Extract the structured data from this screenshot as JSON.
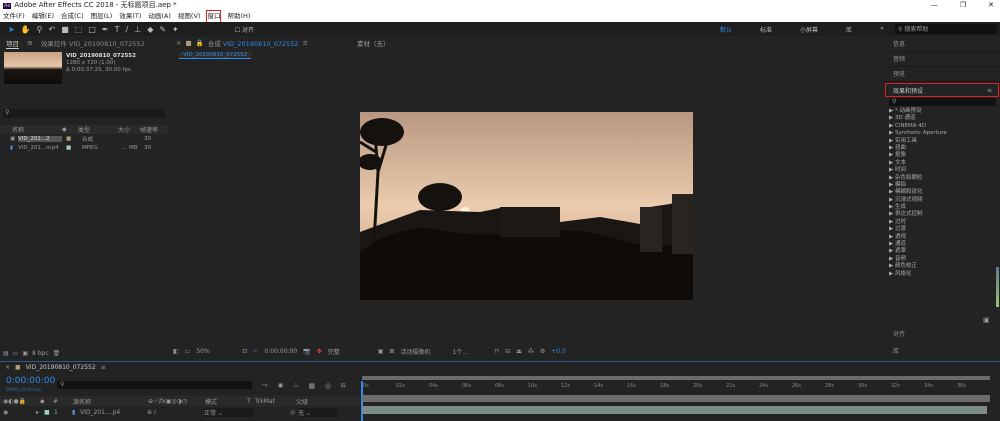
{
  "app": {
    "title": "Adobe After Effects CC 2018 - 无标题项目.aep *",
    "logo": "Ae"
  },
  "window_controls": [
    "—",
    "❐",
    "✕"
  ],
  "menu": [
    "文件(F)",
    "编辑(E)",
    "合成(C)",
    "图层(L)",
    "效果(T)",
    "动画(A)",
    "视图(V)",
    "窗口",
    "帮助(H)"
  ],
  "toolbar": {
    "tools": [
      "selection-icon",
      "hand-icon",
      "zoom-icon",
      "rotate-icon",
      "camera-icon",
      "pan-behind-icon",
      "rectangle-icon",
      "pen-icon",
      "type-icon",
      "brush-icon",
      "clone-stamp-icon",
      "eraser-icon",
      "roto-brush-icon",
      "puppet-pin-icon"
    ],
    "snap_label": "对齐",
    "workspaces": [
      "默认",
      "标准",
      "小屏幕",
      "库"
    ],
    "more": "»",
    "search_placeholder": "搜索帮助"
  },
  "project": {
    "tab": "项目",
    "effects_tab": "效果控件 VID_20190810_072552",
    "item_name": "VID_20190810_072552",
    "item_res": "1280 x 720 (1.00)",
    "item_duration": "Δ 0:00:37:25, 30.00 fps",
    "columns": [
      "名称",
      "类型",
      "大小",
      "帧速率"
    ],
    "rows": [
      {
        "name": "VID_201...2",
        "type": "合成",
        "size": "",
        "fps": "30"
      },
      {
        "name": "VID_201...mp4",
        "type": "MPEG",
        "size": "... MB",
        "fps": "30"
      }
    ],
    "bpc": "8 bpc"
  },
  "viewer": {
    "tab": "合成",
    "comp_name": "VID_20190810_072552",
    "footage_tab": "素材（无）",
    "breadcrumb": "VID_20190810_072552",
    "zoom": "50%",
    "timecode": "0:00:00:00",
    "resolution": "完整",
    "camera": "活动摄像机",
    "views": "1个...",
    "exposure": "+0.0"
  },
  "right_panel": {
    "items": [
      "信息",
      "音频",
      "预览"
    ],
    "effects_title": "效果和预设",
    "effects": [
      "* 动画预设",
      "3D 通道",
      "CINEMA 4D",
      "Synthetic Aperture",
      "实用工具",
      "扭曲",
      "抠像",
      "文本",
      "时间",
      "杂色和颗粒",
      "模拟",
      "模糊和锐化",
      "沉浸式视频",
      "生成",
      "表达式控制",
      "过时",
      "过渡",
      "透视",
      "通道",
      "遮罩",
      "音频",
      "颜色校正",
      "风格化"
    ],
    "bottom": [
      "对齐",
      "库"
    ]
  },
  "timeline": {
    "tab": "VID_20190810_072552",
    "timecode": "0:00:00:00",
    "frames": "00000 (30.00 fps)",
    "columns": [
      "源名称",
      "模式",
      "T",
      "TrkMat",
      "父级"
    ],
    "layer": {
      "index": "1",
      "name": "VID_201....p4",
      "mode": "正常",
      "parent": "无"
    },
    "ruler": [
      "0s",
      "02s",
      "04s",
      "06s",
      "08s",
      "10s",
      "12s",
      "14s",
      "16s",
      "18s",
      "20s",
      "22s",
      "24s",
      "26s",
      "28s",
      "30s",
      "32s",
      "34s",
      "36s"
    ]
  },
  "colors": {
    "accent": "#2d8ceb",
    "highlight_box": "#e02020",
    "layer_bar": "#7d8c89"
  }
}
